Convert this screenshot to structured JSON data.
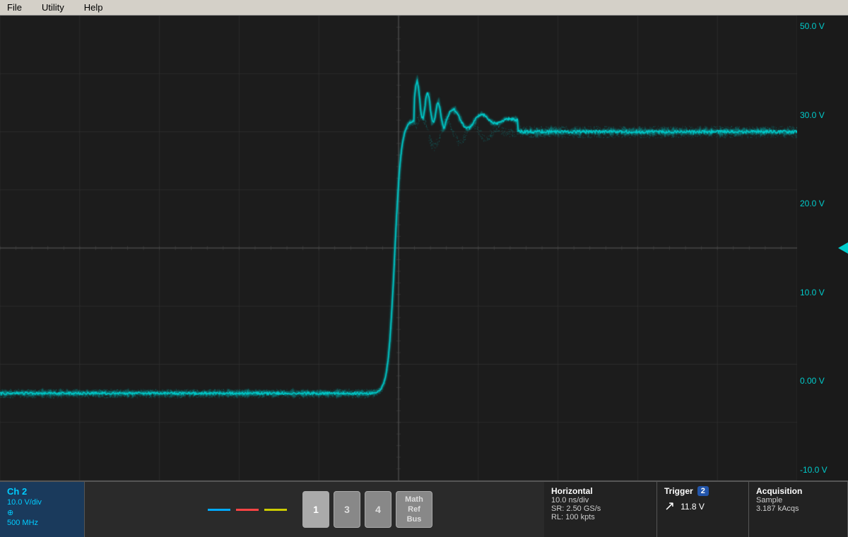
{
  "menubar": {
    "items": [
      "File",
      "Utility",
      "Help"
    ]
  },
  "scope": {
    "background": "#1a1a1a",
    "grid_color": "#3a3a3a",
    "waveform_color": "#00cccc"
  },
  "scale_labels": {
    "values": [
      "50.0 V",
      "30.0 V",
      "20.0 V",
      "10.0 V",
      "0.00 V",
      "-10.0 V"
    ]
  },
  "c2_label": "C2",
  "channel_buttons": [
    {
      "id": "1",
      "label": "1"
    },
    {
      "id": "3",
      "label": "3"
    },
    {
      "id": "4",
      "label": "4"
    }
  ],
  "math_ref_bus": {
    "label": "Math\nRef\nBus"
  },
  "ch_indicators": [
    {
      "color": "#00aaff"
    },
    {
      "color": "#ff4444"
    },
    {
      "color": "#cccc00"
    }
  ],
  "ch2_info": {
    "header": "Ch 2",
    "vdiv": "10.0 V/div",
    "bw": "500 MHz"
  },
  "horizontal": {
    "header": "Horizontal",
    "time_div": "10.0 ns/div",
    "sample_rate": "SR: 2.50 GS/s",
    "record_length": "RL: 100 kpts"
  },
  "trigger": {
    "header": "Trigger",
    "channel": "2",
    "value": "11.8 V"
  },
  "acquisition": {
    "header": "Acquisition",
    "mode": "Sample",
    "rate": "3.187 kAcqs"
  }
}
